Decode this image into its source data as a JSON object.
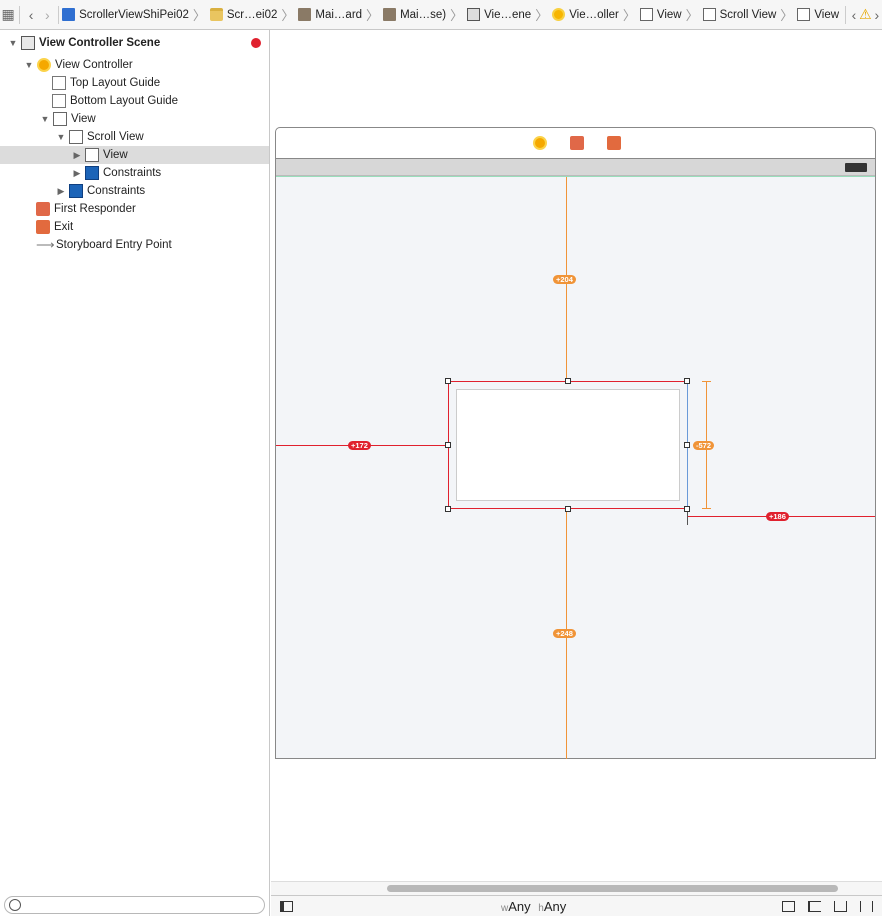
{
  "jumpbar": {
    "crumbs": [
      {
        "label": "ScrollerViewShiPei02",
        "icon": "project-file-icon"
      },
      {
        "label": "Scr…ei02",
        "icon": "folder-icon"
      },
      {
        "label": "Mai…ard",
        "icon": "storyboard-icon"
      },
      {
        "label": "Mai…se)",
        "icon": "storyboard-icon"
      },
      {
        "label": "Vie…ene",
        "icon": "scene-icon"
      },
      {
        "label": "Vie…oller",
        "icon": "view-controller-icon"
      },
      {
        "label": "View",
        "icon": "view-icon"
      },
      {
        "label": "Scroll View",
        "icon": "view-icon"
      },
      {
        "label": "View",
        "icon": "view-icon"
      }
    ]
  },
  "outline": {
    "items": [
      {
        "label": "View Controller Scene",
        "icon": "scene-icon",
        "bold": true,
        "disclosure": "open"
      },
      {
        "label": "View Controller",
        "icon": "view-controller-icon",
        "disclosure": "open"
      },
      {
        "label": "Top Layout Guide",
        "icon": "layout-guide-icon"
      },
      {
        "label": "Bottom Layout Guide",
        "icon": "layout-guide-icon"
      },
      {
        "label": "View",
        "icon": "view-icon",
        "disclosure": "open"
      },
      {
        "label": "Scroll View",
        "icon": "view-icon",
        "disclosure": "open"
      },
      {
        "label": "View",
        "icon": "view-icon",
        "disclosure": "closed",
        "selected": true
      },
      {
        "label": "Constraints",
        "icon": "constraints-icon",
        "disclosure": "closed"
      },
      {
        "label": "Constraints",
        "icon": "constraints-icon",
        "disclosure": "closed"
      },
      {
        "label": "First Responder",
        "icon": "first-responder-icon"
      },
      {
        "label": "Exit",
        "icon": "exit-icon"
      },
      {
        "label": "Storyboard Entry Point",
        "icon": "entry-point-arrow-icon"
      }
    ]
  },
  "canvas": {
    "constraints": {
      "top": "+204",
      "leading": "+172",
      "height": "-572",
      "trailing": "+186",
      "bottom": "+248"
    }
  },
  "bottombar": {
    "width_prefix": "w",
    "width_value": "Any",
    "height_prefix": "h",
    "height_value": "Any"
  },
  "colors": {
    "constraint_orange": "#f09438",
    "constraint_red": "#e0212e",
    "canvas_bg": "#f3f5f8",
    "selection": "#dcdcdc"
  }
}
